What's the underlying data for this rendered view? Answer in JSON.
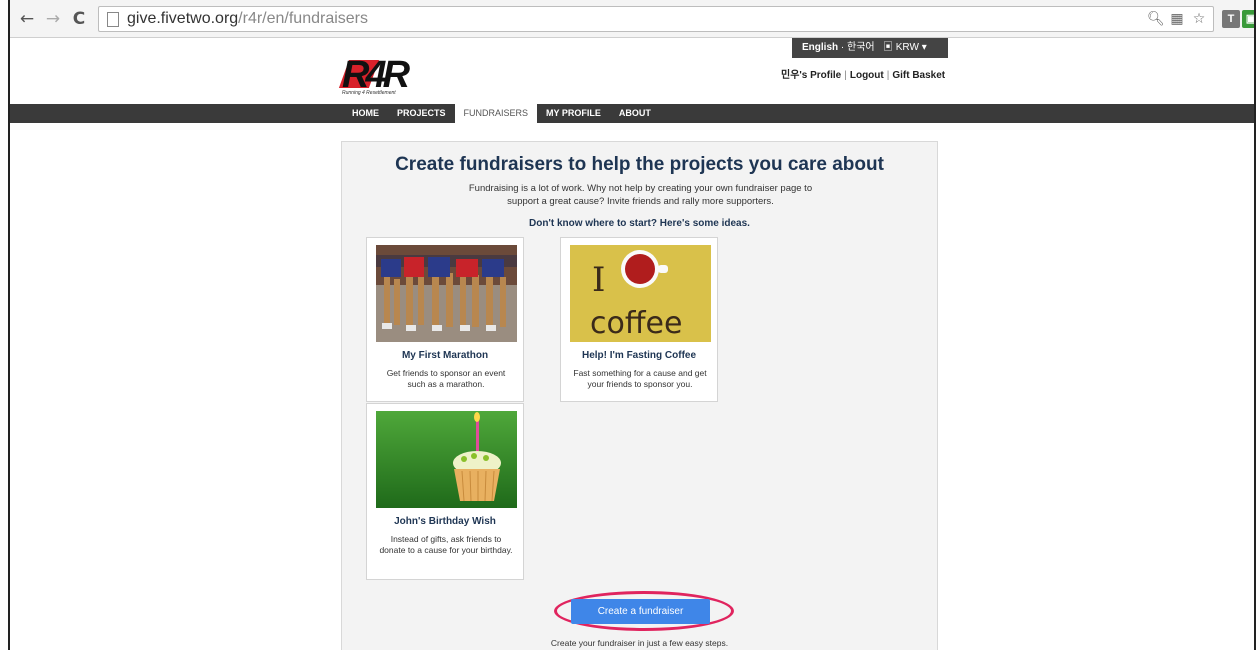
{
  "browser": {
    "url_host": "give.fivetwo.org",
    "url_path": "/r4r/en/fundraisers",
    "ext1": "T"
  },
  "header": {
    "logo_text": "R4R",
    "logo_subtitle": "Running 4 Resettlement",
    "lang_current": "English",
    "lang_alt": "한국어",
    "currency": "KRW",
    "links": [
      "민우's Profile",
      "Logout",
      "Gift Basket"
    ]
  },
  "nav": {
    "items": [
      "HOME",
      "PROJECTS",
      "FUNDRAISERS",
      "MY PROFILE",
      "ABOUT"
    ],
    "active": "FUNDRAISERS"
  },
  "main": {
    "headline": "Create fundraisers to help the projects you care about",
    "intro": "Fundraising is a lot of work. Why not help by creating your own fundraiser page to support a great cause? Invite friends and rally more supporters.",
    "ideas_heading": "Don't know where to start? Here's some ideas.",
    "cards": [
      {
        "title": "My First Marathon",
        "desc": "Get friends to sponsor an event such as a marathon."
      },
      {
        "title": "Help! I'm Fasting Coffee",
        "desc": "Fast something for a cause and get your friends to sponsor you.",
        "image_text_top": "I",
        "image_text_bottom": "coffee"
      },
      {
        "title": "John's Birthday Wish",
        "desc": "Instead of gifts, ask friends to donate to a cause for your birthday."
      }
    ],
    "cta_label": "Create a fundraiser",
    "cta_note": "Create your fundraiser in just a few easy steps."
  },
  "colors": {
    "accent": "#3f86e8",
    "heading": "#1e3553",
    "highlight_ring": "#e0245e",
    "logo_red": "#d8212a"
  }
}
